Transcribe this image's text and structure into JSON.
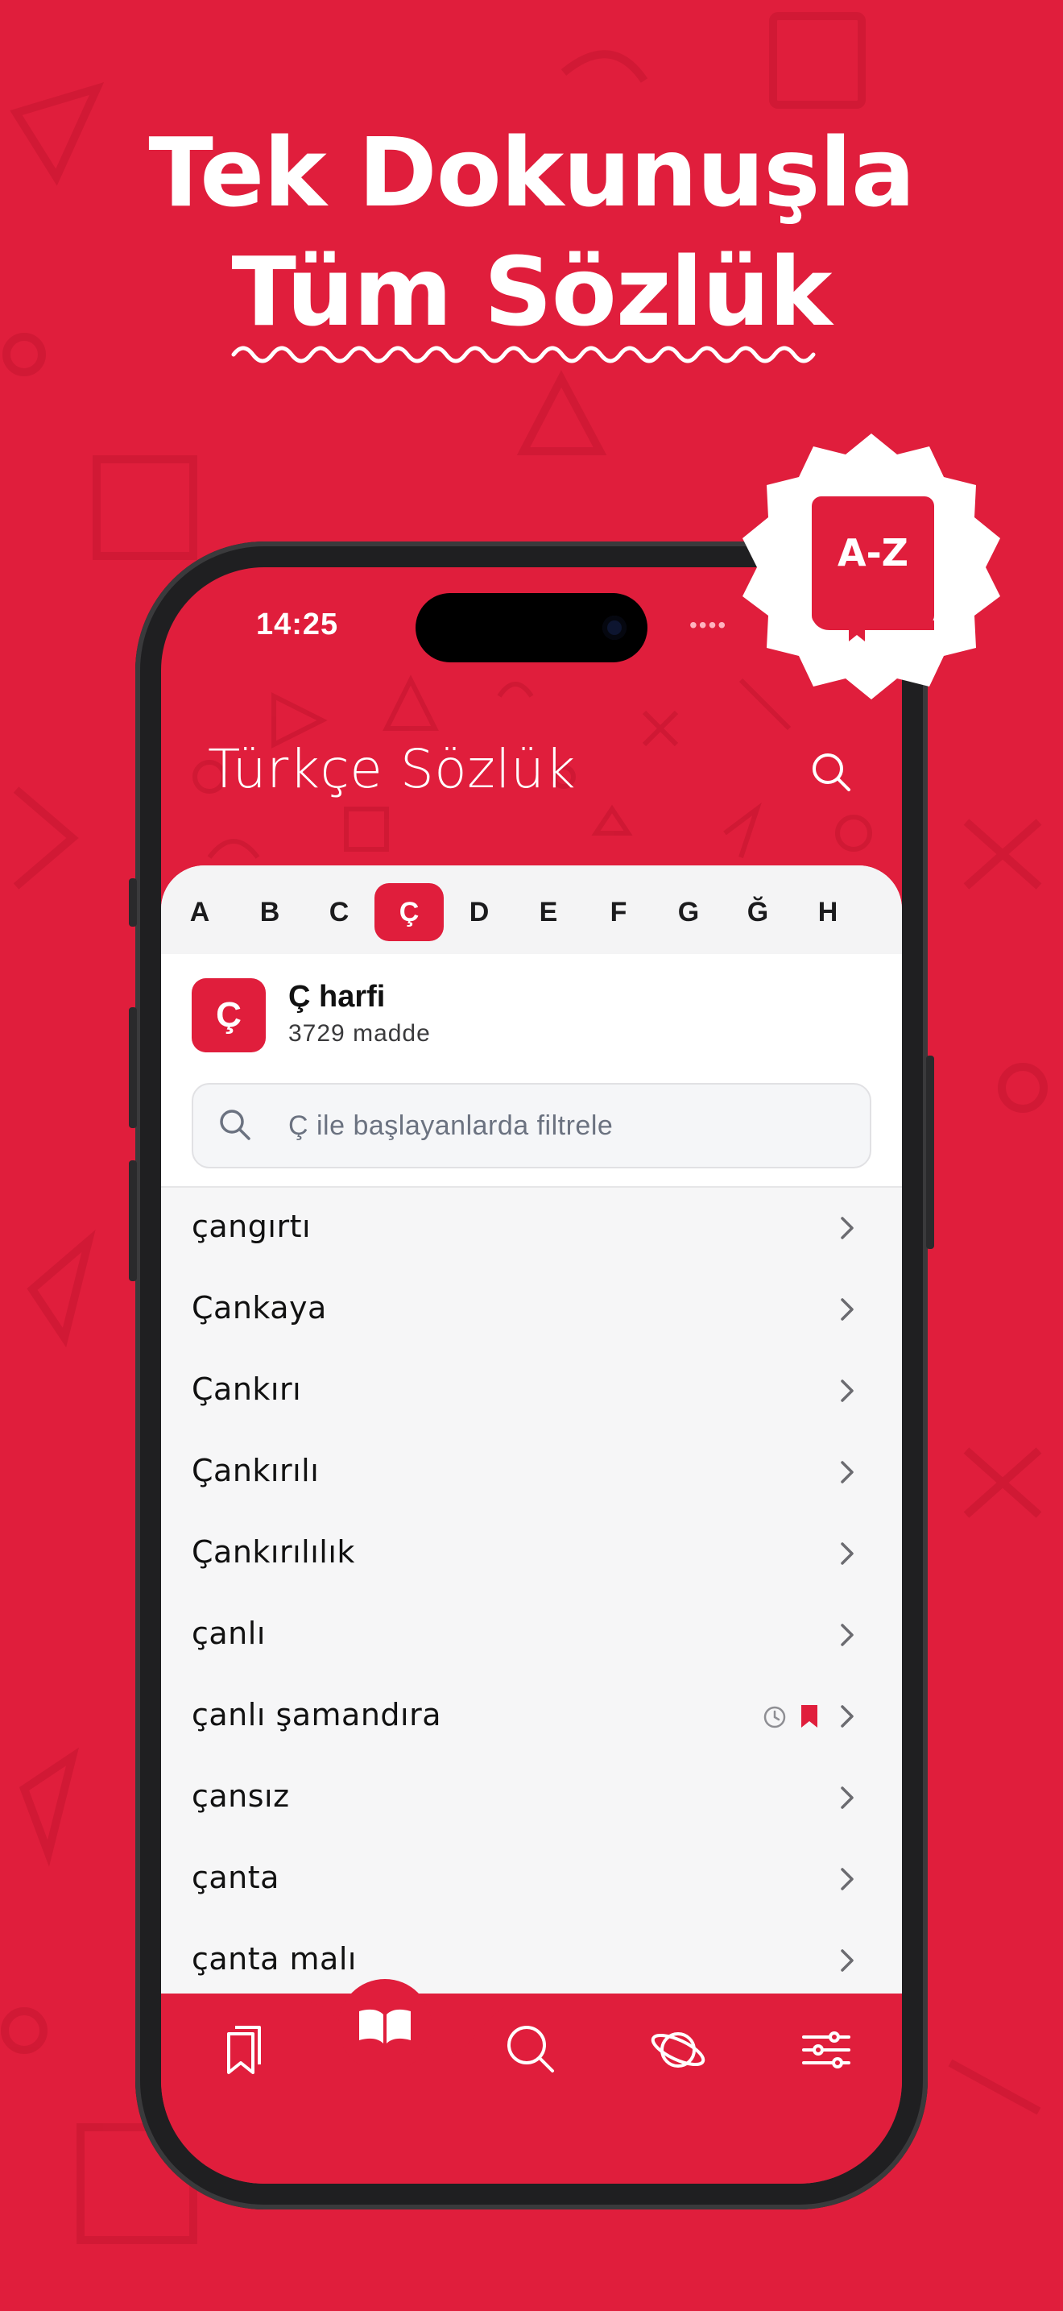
{
  "colors": {
    "brand": "#E01E3C",
    "white": "#FFFFFF",
    "sheet": "#F6F6F7"
  },
  "headline": {
    "line1": "Tek Dokunuşla",
    "line2": "Tüm Sözlük"
  },
  "badge": {
    "icon": "book-az-icon",
    "text": "A-Z"
  },
  "status_bar": {
    "time": "14:25",
    "signal": "••••"
  },
  "header": {
    "title": "Türkçe Sözlük",
    "search_icon": "search-icon"
  },
  "alphabet": {
    "letters": [
      "A",
      "B",
      "C",
      "Ç",
      "D",
      "E",
      "F",
      "G",
      "Ğ",
      "H"
    ],
    "selected": "Ç"
  },
  "letter_info": {
    "letter": "Ç",
    "title": "Ç harfi",
    "count": "3729 madde"
  },
  "filter": {
    "placeholder": "Ç ile başlayanlarda filtrele"
  },
  "words": [
    {
      "text": "çangırtı"
    },
    {
      "text": "Çankaya"
    },
    {
      "text": "Çankırı"
    },
    {
      "text": "Çankırılı"
    },
    {
      "text": "Çankırılılık"
    },
    {
      "text": "çanlı"
    },
    {
      "text": "çanlı şamandıra",
      "history": true,
      "bookmarked": true
    },
    {
      "text": "çansız"
    },
    {
      "text": "çanta"
    },
    {
      "text": "çanta malı"
    }
  ],
  "tabs": [
    {
      "name": "bookmarks",
      "icon": "bookmarks-icon"
    },
    {
      "name": "dictionary",
      "icon": "open-book-icon",
      "active": true
    },
    {
      "name": "search",
      "icon": "search-icon"
    },
    {
      "name": "explore",
      "icon": "planet-icon"
    },
    {
      "name": "settings",
      "icon": "sliders-icon"
    }
  ]
}
